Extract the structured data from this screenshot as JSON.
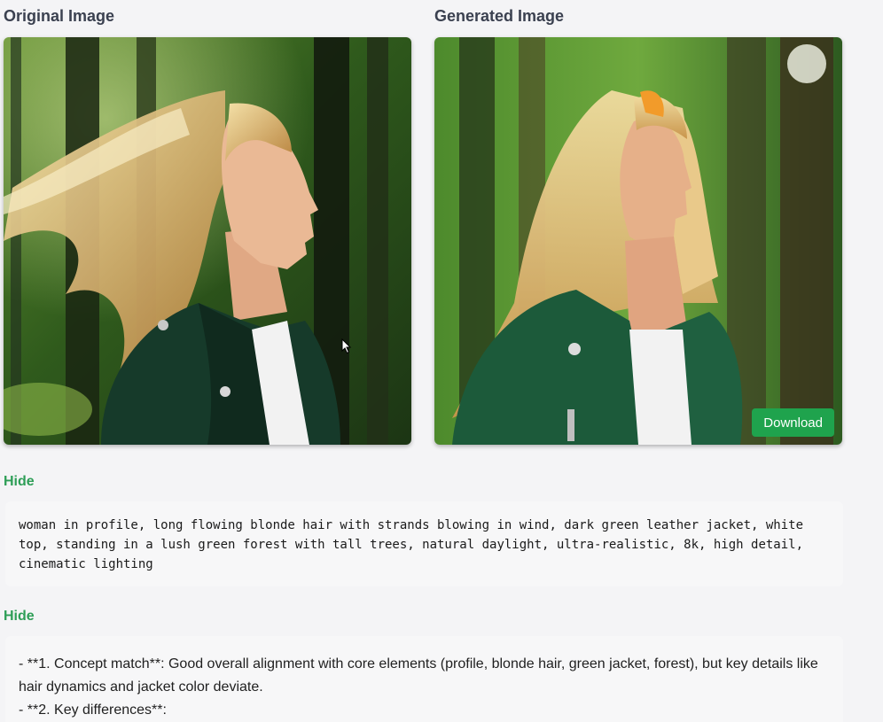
{
  "original": {
    "title": "Original Image"
  },
  "generated": {
    "title": "Generated Image",
    "download_label": "Download"
  },
  "prompt_section": {
    "toggle_label": "Hide",
    "text": "woman in profile, long flowing blonde hair with strands blowing in wind, dark green leather jacket, white top, standing in a lush green forest with tall trees, natural daylight, ultra-realistic, 8k, high detail, cinematic lighting"
  },
  "analysis_section": {
    "toggle_label": "Hide",
    "lines": [
      "- **1. Concept match**: Good overall alignment with core elements (profile, blonde hair, green jacket, forest), but key details like hair dynamics and jacket color deviate.",
      "- **2. Key differences**:"
    ]
  },
  "colors": {
    "accent_green": "#2e9e57",
    "download_green": "#1fa34d",
    "heading_gray": "#3b4150"
  }
}
